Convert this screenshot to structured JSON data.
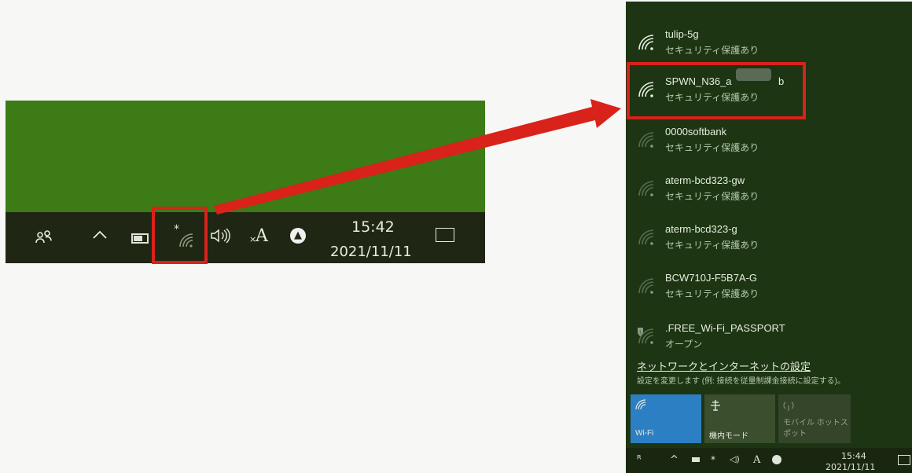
{
  "taskbar": {
    "time": "15:42",
    "date": "2021/11/11",
    "ime_label": "A",
    "ime_badge": "×",
    "icons": [
      "people-icon",
      "chevron-up-icon",
      "battery-icon",
      "wifi-disconnected-icon",
      "volume-icon",
      "ime-icon",
      "app-icon",
      "notification-icon"
    ]
  },
  "networks": [
    {
      "name": "tulip-5g",
      "status": "セキュリティ保護あり",
      "strength": "full"
    },
    {
      "name": "SPWN_N36_a",
      "name_suffix": "b",
      "status": "セキュリティ保護あり",
      "strength": "full"
    },
    {
      "name": "0000softbank",
      "status": "セキュリティ保護あり",
      "strength": "weak"
    },
    {
      "name": "aterm-bcd323-gw",
      "status": "セキュリティ保護あり",
      "strength": "weak"
    },
    {
      "name": "aterm-bcd323-g",
      "status": "セキュリティ保護あり",
      "strength": "weak"
    },
    {
      "name": "BCW710J-F5B7A-G",
      "status": "セキュリティ保護あり",
      "strength": "weak"
    },
    {
      "name": ".FREE_Wi-Fi_PASSPORT",
      "status": "オープン",
      "strength": "weak"
    }
  ],
  "settings": {
    "link": "ネットワークとインターネットの設定",
    "description": "設定を変更します (例: 接続を従量制課金接続に設定する)。"
  },
  "quick_actions": [
    {
      "label": "Wi-Fi",
      "active": true
    },
    {
      "label": "機内モード",
      "active": false
    },
    {
      "label": "モバイル ホットスポット",
      "active": false
    }
  ],
  "flyout_taskbar": {
    "time": "15:44",
    "date": "2021/11/11"
  },
  "colors": {
    "highlight": "#d8221a",
    "wifi_tile": "#2d7fc4",
    "taskbar_green": "#3c7b15"
  }
}
